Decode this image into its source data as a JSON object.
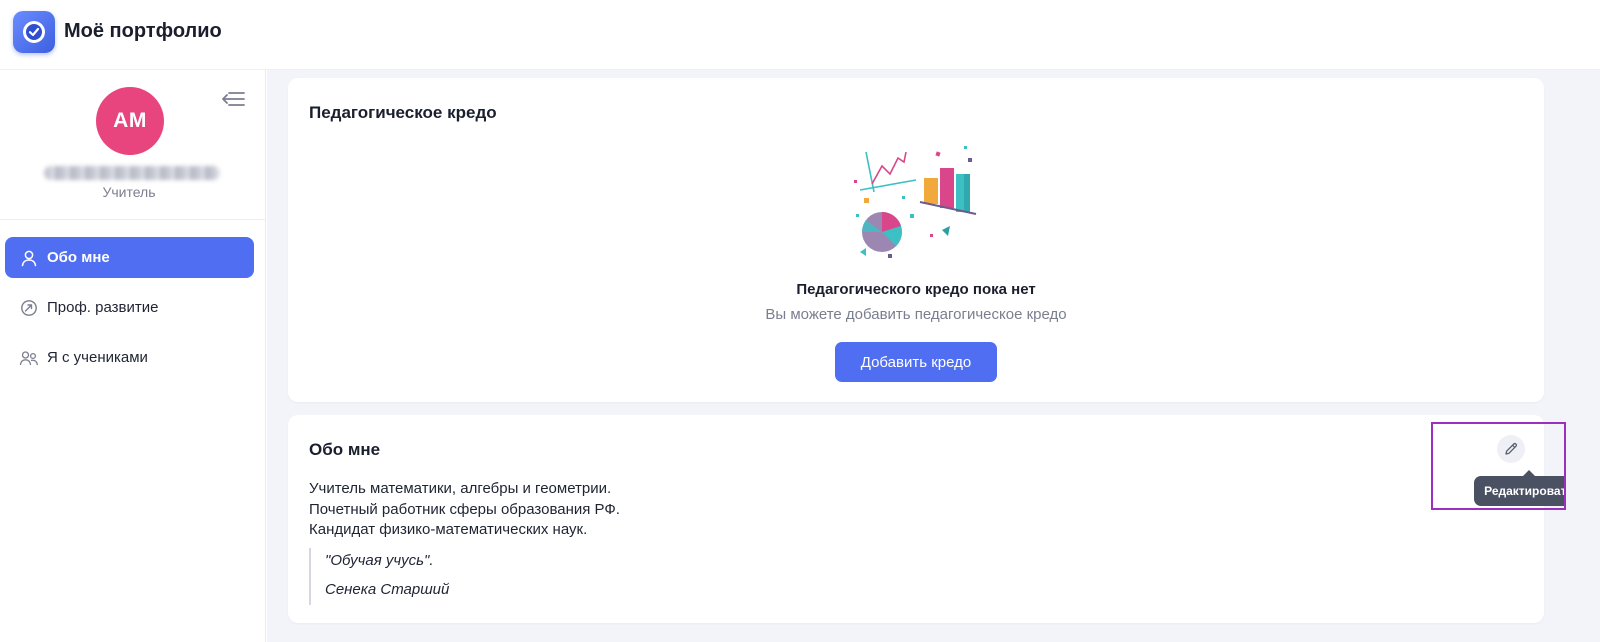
{
  "app": {
    "title": "Моё портфолио"
  },
  "sidebar": {
    "avatar_initials": "АМ",
    "role": "Учитель",
    "items": [
      {
        "label": "Обо мне",
        "icon": "user-icon",
        "active": true
      },
      {
        "label": "Проф. развитие",
        "icon": "growth-icon",
        "active": false
      },
      {
        "label": "Я с учениками",
        "icon": "users-icon",
        "active": false
      }
    ]
  },
  "credo": {
    "title": "Педагогическое кредо",
    "empty_title": "Педагогического кредо пока нет",
    "empty_subtitle": "Вы можете добавить педагогическое кредо",
    "add_button": "Добавить кредо"
  },
  "about": {
    "title": "Обо мне",
    "lines": [
      "Учитель математики, алгебры и геометрии.",
      "Почетный работник сферы образования РФ.",
      "Кандидат физико-математических наук."
    ],
    "quote": "\"Обучая учусь\".",
    "quote_author": "Сенека Старший",
    "edit_tooltip": "Редактировать"
  },
  "colors": {
    "accent": "#4f6ef2",
    "avatar": "#e8457f",
    "tooltip": "#4a5163",
    "highlight": "#9b2fc0"
  }
}
